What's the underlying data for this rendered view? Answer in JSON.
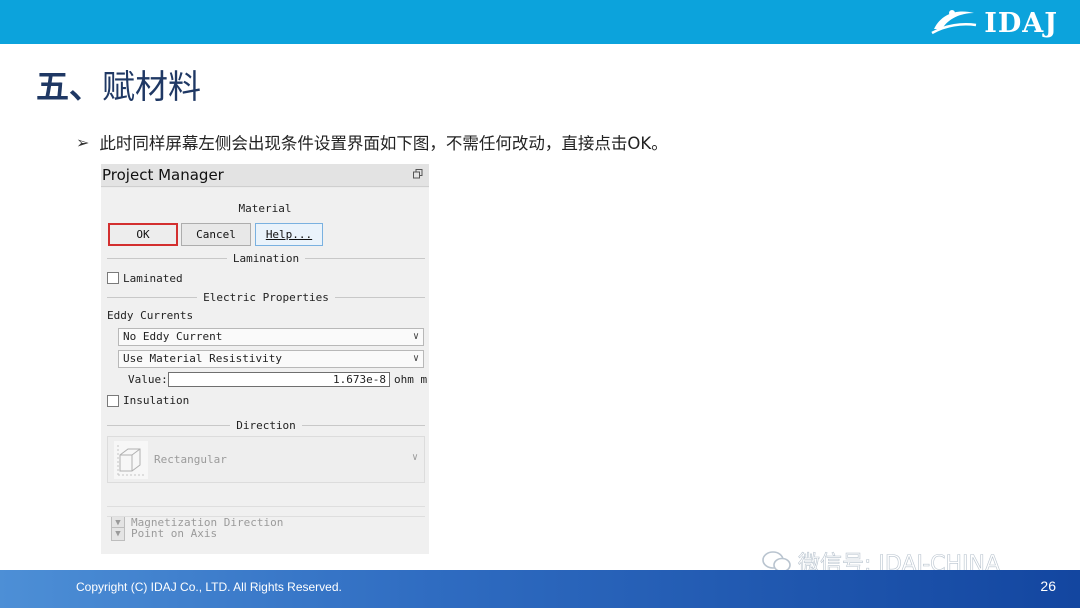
{
  "slide": {
    "brand": "IDAJ",
    "title_prefix": "五、",
    "title_rest": "赋材料",
    "bullet": "此时同样屏幕左侧会出现条件设置界面如下图，不需任何改动，直接点击OK。",
    "copyright": "Copyright (C) IDAJ Co., LTD. All Rights Reserved.",
    "page_number": "26",
    "watermark": "微信号: IDAJ-CHINA"
  },
  "panel": {
    "title": "Project Manager",
    "section_title": "Material",
    "buttons": {
      "ok": "OK",
      "cancel": "Cancel",
      "help": "Help..."
    },
    "lamination": {
      "header": "Lamination",
      "laminated_label": "Laminated",
      "laminated_checked": false
    },
    "electric": {
      "header": "Electric Properties",
      "eddy_label": "Eddy Currents",
      "eddy_select": "No Eddy Current",
      "resistivity_select": "Use Material Resistivity",
      "value_label": "Value:",
      "value": "1.673e-8",
      "unit": "ohm m",
      "insulation_label": "Insulation",
      "insulation_checked": false
    },
    "direction": {
      "header": "Direction",
      "type_select": "Rectangular",
      "magnetization_label": "Magnetization Direction",
      "point_label": "Point on Axis"
    }
  },
  "colors": {
    "top_bar": "#0ca3dc",
    "title": "#1f3864",
    "ok_highlight": "#d32f2f",
    "bottom_bar": "#1346a0"
  }
}
